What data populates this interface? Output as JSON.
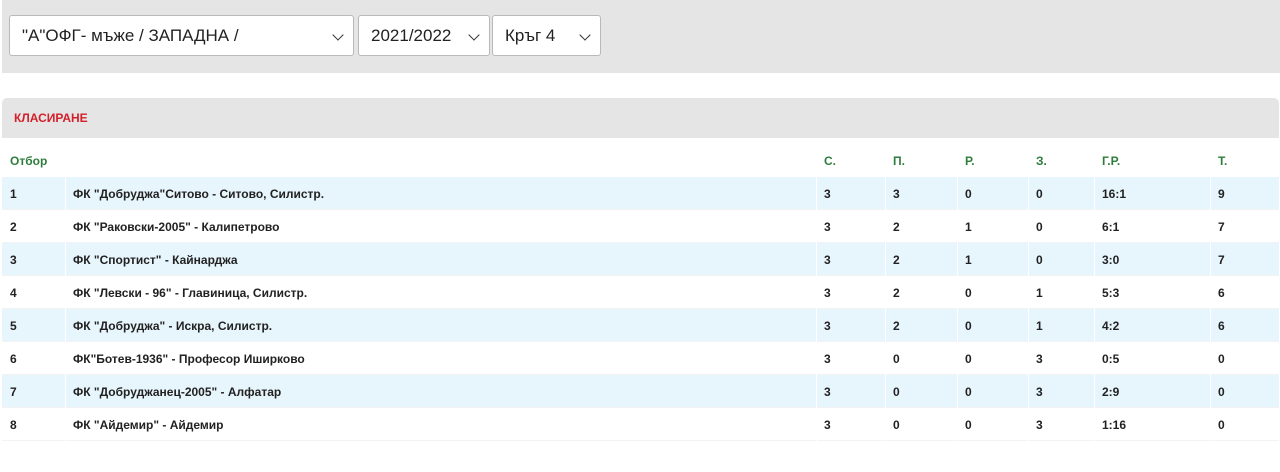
{
  "filters": {
    "league": "\"А\"ОФГ- мъже / ЗАПАДНА /",
    "season": "2021/2022",
    "round": "Кръг 4"
  },
  "section": {
    "title": "КЛАСИРАНЕ"
  },
  "table": {
    "headers": {
      "team": "Отбор",
      "played": "С.",
      "won": "П.",
      "drawn": "Р.",
      "lost": "З.",
      "goals": "Г.Р.",
      "points": "Т."
    },
    "rows": [
      {
        "rank": "1",
        "team": "ФК \"Добруджа\"Ситово - Ситово, Силистр.",
        "played": "3",
        "won": "3",
        "drawn": "0",
        "lost": "0",
        "goals": "16:1",
        "points": "9"
      },
      {
        "rank": "2",
        "team": "ФК \"Раковски-2005\" - Калипетрово",
        "played": "3",
        "won": "2",
        "drawn": "1",
        "lost": "0",
        "goals": "6:1",
        "points": "7"
      },
      {
        "rank": "3",
        "team": "ФК \"Спортист\" - Кайнарджа",
        "played": "3",
        "won": "2",
        "drawn": "1",
        "lost": "0",
        "goals": "3:0",
        "points": "7"
      },
      {
        "rank": "4",
        "team": "ФК \"Левски - 96\" - Главиница, Силистр.",
        "played": "3",
        "won": "2",
        "drawn": "0",
        "lost": "1",
        "goals": "5:3",
        "points": "6"
      },
      {
        "rank": "5",
        "team": "ФК \"Добруджа\" - Искра, Силистр.",
        "played": "3",
        "won": "2",
        "drawn": "0",
        "lost": "1",
        "goals": "4:2",
        "points": "6"
      },
      {
        "rank": "6",
        "team": "ФК\"Ботев-1936\" - Професор Иширково",
        "played": "3",
        "won": "0",
        "drawn": "0",
        "lost": "3",
        "goals": "0:5",
        "points": "0"
      },
      {
        "rank": "7",
        "team": "ФК \"Добруджанец-2005\" - Алфатар",
        "played": "3",
        "won": "0",
        "drawn": "0",
        "lost": "3",
        "goals": "2:9",
        "points": "0"
      },
      {
        "rank": "8",
        "team": "ФК \"Айдемир\" - Айдемир",
        "played": "3",
        "won": "0",
        "drawn": "0",
        "lost": "3",
        "goals": "1:16",
        "points": "0"
      }
    ]
  }
}
